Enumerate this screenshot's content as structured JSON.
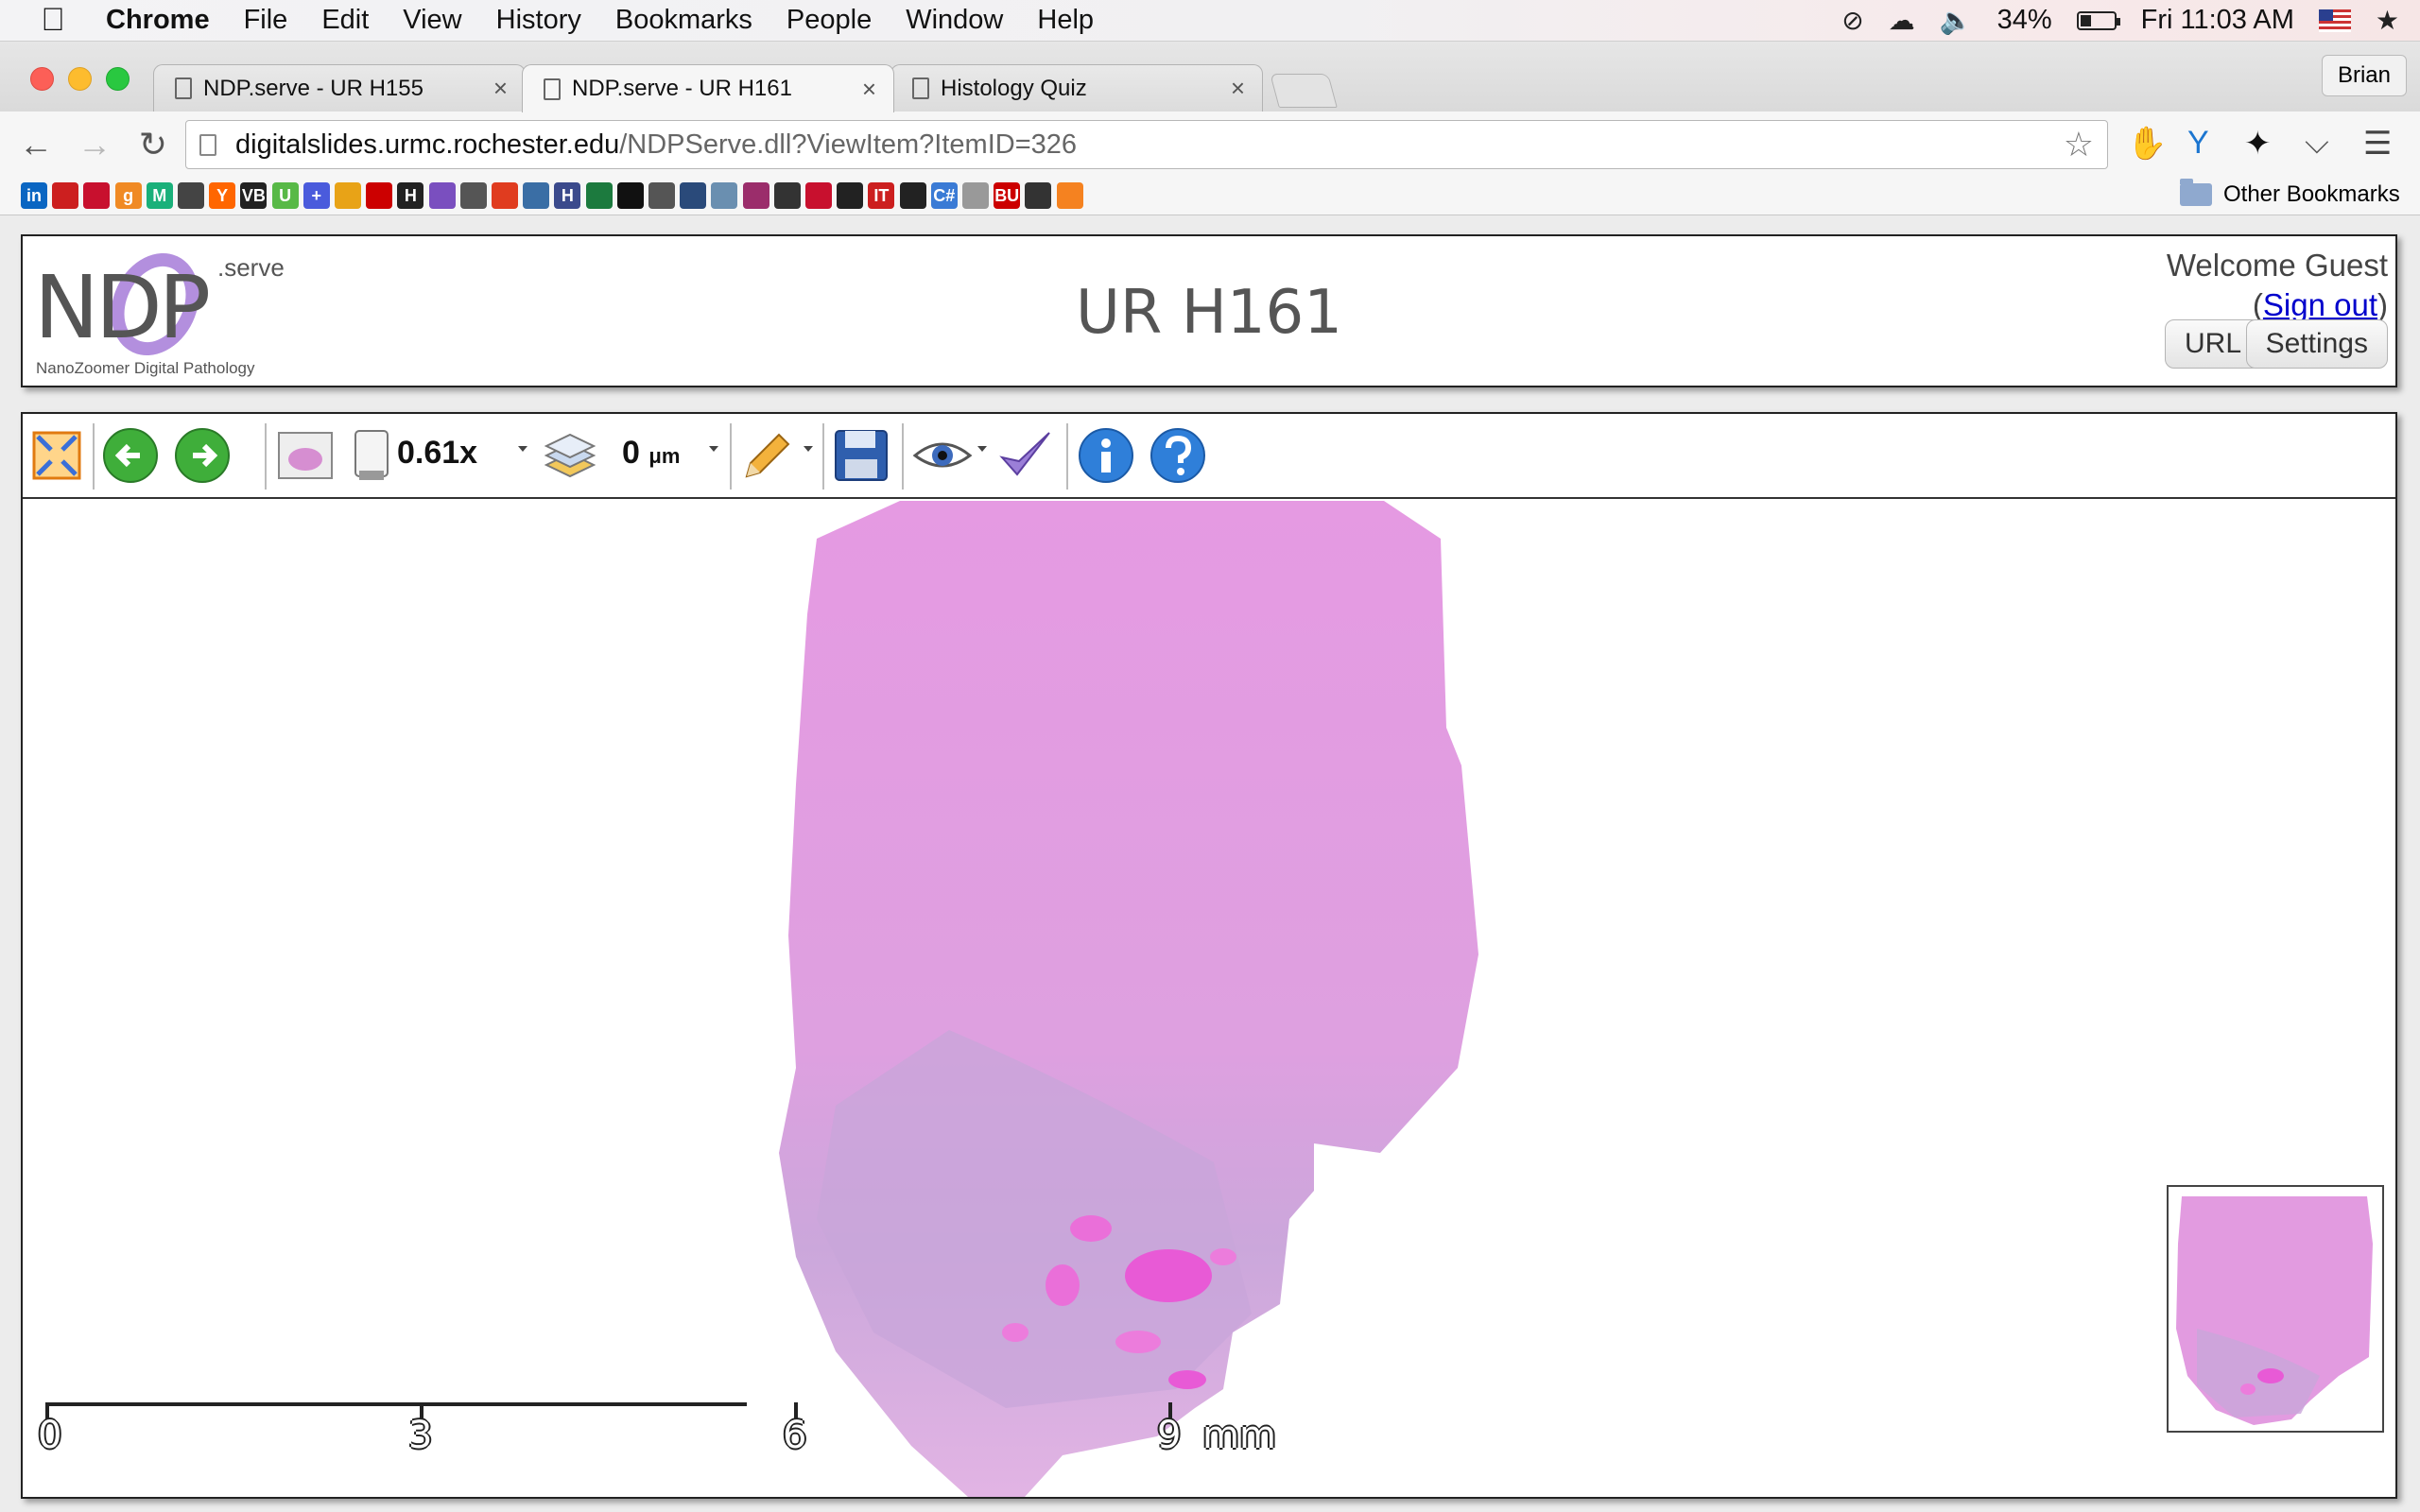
{
  "menubar": {
    "app": "Chrome",
    "items": [
      "File",
      "Edit",
      "View",
      "History",
      "Bookmarks",
      "People",
      "Window",
      "Help"
    ],
    "battery": "34%",
    "battery_level": 0.34,
    "clock": "Fri 11:03 AM"
  },
  "tabs": [
    {
      "title": "NDP.serve - UR H155",
      "close": "×"
    },
    {
      "title": "NDP.serve - UR H161",
      "close": "×"
    },
    {
      "title": "Histology Quiz",
      "close": "×"
    }
  ],
  "profile": "Brian",
  "omnibox": {
    "host": "digitalslides.urmc.rochester.edu",
    "path": "/NDPServe.dll?ViewItem?ItemID=326"
  },
  "bookmarks": {
    "other_label": "Other Bookmarks",
    "items": [
      {
        "label": "in",
        "color": "#0a66c2",
        "icon": "linkedin-icon"
      },
      {
        "label": "",
        "color": "#cc1f1f",
        "icon": "bookmark-red-icon"
      },
      {
        "label": "",
        "color": "#c8102e",
        "icon": "bank-icon"
      },
      {
        "label": "g",
        "color": "#f08a24",
        "icon": "goodreads-icon"
      },
      {
        "label": "M",
        "color": "#1ab07a",
        "icon": "m-icon"
      },
      {
        "label": "",
        "color": "#444444",
        "icon": "news-icon"
      },
      {
        "label": "Y",
        "color": "#ff6600",
        "icon": "hacker-news-icon"
      },
      {
        "label": "VB",
        "color": "#222222",
        "icon": "vb-icon"
      },
      {
        "label": "U",
        "color": "#58b947",
        "icon": "u-icon"
      },
      {
        "label": "+",
        "color": "#4a5bdc",
        "icon": "plus-icon"
      },
      {
        "label": "",
        "color": "#e8a317",
        "icon": "pinwheel-icon"
      },
      {
        "label": "",
        "color": "#cc0000",
        "icon": "grid-icon"
      },
      {
        "label": "H",
        "color": "#222222",
        "icon": "hx-icon"
      },
      {
        "label": "",
        "color": "#7a4fbf",
        "icon": "dots-icon"
      },
      {
        "label": "",
        "color": "#555555",
        "icon": "app-icon"
      },
      {
        "label": "",
        "color": "#e03c1f",
        "icon": "tomato-icon"
      },
      {
        "label": "",
        "color": "#3a6ea5",
        "icon": "database-icon"
      },
      {
        "label": "H",
        "color": "#3b4a8c",
        "icon": "h-icon"
      },
      {
        "label": "",
        "color": "#1c7a3e",
        "icon": "chart-icon"
      },
      {
        "label": "",
        "color": "#111111",
        "icon": "bow-icon"
      },
      {
        "label": "",
        "color": "#555555",
        "icon": "stripes-icon"
      },
      {
        "label": "",
        "color": "#2a4a7a",
        "icon": "octopus-icon"
      },
      {
        "label": "",
        "color": "#6a8fb0",
        "icon": "molecule-icon"
      },
      {
        "label": "",
        "color": "#9b2d6b",
        "icon": "feather-icon"
      },
      {
        "label": "",
        "color": "#333333",
        "icon": "brush-icon"
      },
      {
        "label": "",
        "color": "#c8102e",
        "icon": "bars-icon"
      },
      {
        "label": "",
        "color": "#222222",
        "icon": "book-icon"
      },
      {
        "label": "IT",
        "color": "#cc1f1f",
        "icon": "it-icon"
      },
      {
        "label": "",
        "color": "#222222",
        "icon": "github-icon"
      },
      {
        "label": "C#",
        "color": "#3a7bd5",
        "icon": "csharp-icon"
      },
      {
        "label": "",
        "color": "#999999",
        "icon": "page-icon"
      },
      {
        "label": "BU",
        "color": "#cc0000",
        "icon": "bu-icon"
      },
      {
        "label": "",
        "color": "#333333",
        "icon": "cross-icon"
      },
      {
        "label": "",
        "color": "#f58220",
        "icon": "hexagon-icon"
      }
    ]
  },
  "ndp": {
    "logo_main": "NDP",
    "logo_serve": ".serve",
    "logo_tagline": "NanoZoomer Digital Pathology",
    "slide_title": "UR H161",
    "welcome": "Welcome Guest",
    "signout_open": "(",
    "signout": "Sign out",
    "signout_close": ")",
    "url_button": "URL",
    "settings_button": "Settings"
  },
  "viewer": {
    "zoom": "0.61x",
    "focus_value": "0",
    "focus_unit": "μm",
    "scale_labels": [
      "0",
      "3",
      "6",
      "9"
    ],
    "scale_unit": "mm"
  },
  "colors": {
    "tissue_pink": "#e199e0",
    "tissue_purple": "#c7a0d8",
    "eosin_dark": "#e85ad6",
    "logo_purple": "#b38fde"
  }
}
